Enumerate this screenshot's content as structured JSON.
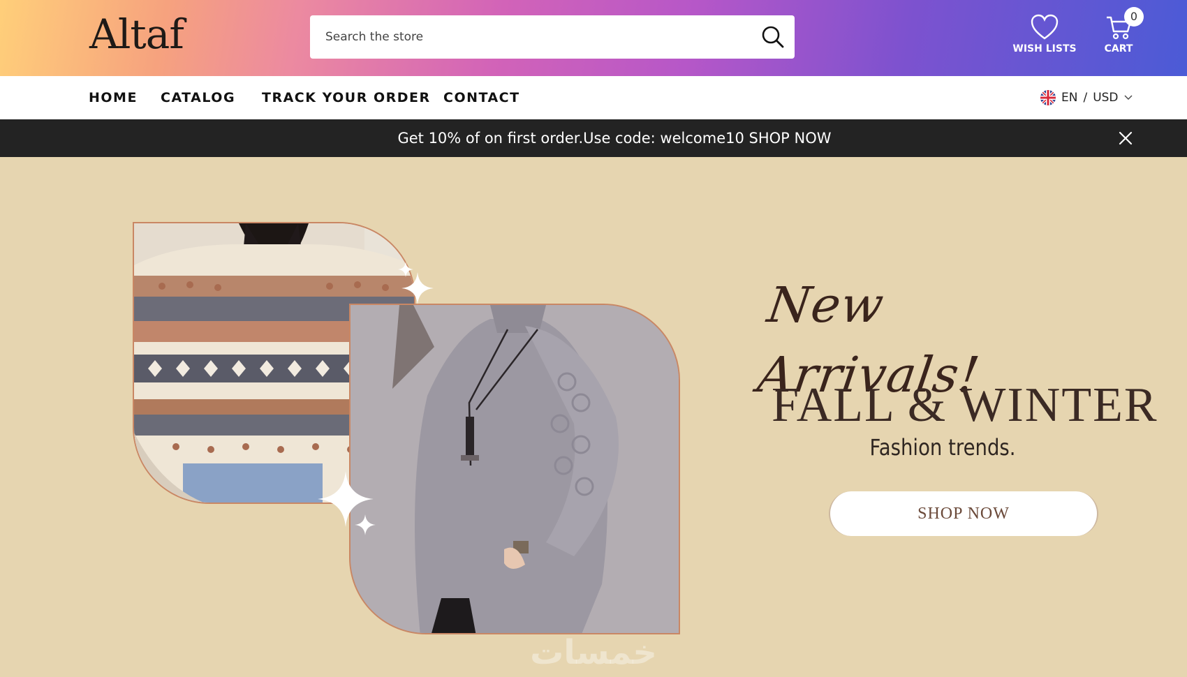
{
  "header": {
    "logo_text": "Altaf",
    "search_placeholder": "Search the store",
    "wishlist_label": "WISH LISTS",
    "cart_label": "CART",
    "cart_count": "0"
  },
  "nav": {
    "items": [
      "HOME",
      "CATALOG",
      "TRACK YOUR ORDER",
      "CONTACT"
    ],
    "language": "EN",
    "currency": "USD",
    "separator": "/"
  },
  "promo": {
    "text": "Get 10% of on first order.Use code: welcome10 SHOP NOW"
  },
  "hero": {
    "script_title": "New Arrivals!",
    "title": "FALL & WINTER",
    "subtitle": "Fashion trends.",
    "cta": "SHOP NOW",
    "watermark": "خمسات"
  },
  "colors": {
    "hero_background": "#e6d5b0",
    "promo_bar": "#232323",
    "frame_border": "#c98764",
    "title_text": "#3b2a24"
  },
  "icons": [
    "search-icon",
    "heart-icon",
    "cart-icon",
    "uk-flag-icon",
    "chevron-down-icon",
    "close-icon",
    "sparkle-icon"
  ]
}
